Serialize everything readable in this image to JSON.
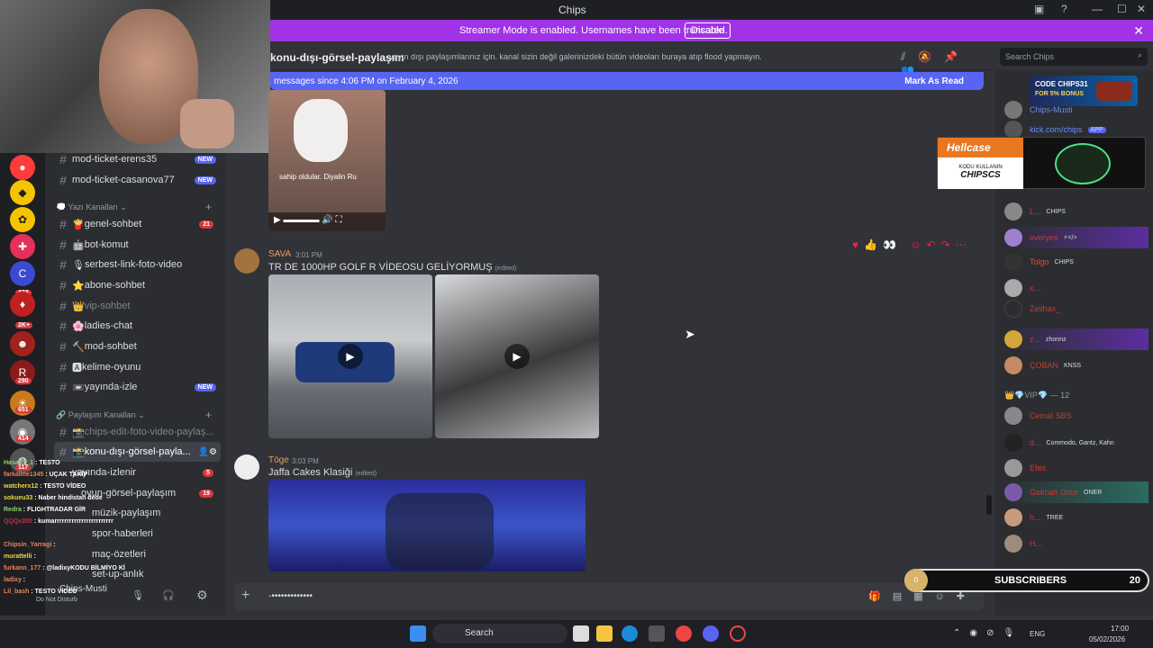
{
  "window": {
    "title": "Chips"
  },
  "banner": {
    "text": "Streamer Mode is enabled. Usernames have been truncated.",
    "button": "Disable"
  },
  "header": {
    "channel": "konu-dışı-görsel-paylaşım",
    "topic": "yayın dışı paylaşımlarınız için. kanal sizin değil galerinizdeki bütün videoları buraya atıp flood yapmayın.",
    "search_placeholder": "Search Chips"
  },
  "newbar": {
    "text": "messages since 4:06 PM on February 4, 2026",
    "action": "Mark As Read"
  },
  "rail_badges": [
    "433",
    "2K+",
    "290",
    "651",
    "414",
    "117"
  ],
  "sidebar": {
    "channels_top": [
      {
        "name": "mod-ticket-erens35",
        "badge": "NEW"
      },
      {
        "name": "mod-ticket-casanova77",
        "badge": "NEW"
      }
    ],
    "category1": "Yazı Kanalları",
    "channels": [
      {
        "name": "genel-sohbet",
        "prefix": "🍟",
        "count": "21"
      },
      {
        "name": "bot-komut",
        "prefix": "🤖"
      },
      {
        "name": "serbest-link-foto-video",
        "prefix": "🎙"
      },
      {
        "name": "abone-sohbet",
        "prefix": "⭐"
      },
      {
        "name": "vip-sohbet",
        "prefix": "👑",
        "muted": true
      },
      {
        "name": "ladies-chat",
        "prefix": "🌸"
      },
      {
        "name": "mod-sohbet",
        "prefix": "🔨"
      },
      {
        "name": "kelime-oyunu",
        "prefix": "🅰"
      },
      {
        "name": "yayında-izle",
        "prefix": "📼",
        "badge": "NEW"
      }
    ],
    "category2": "Paylaşım Kanalları",
    "channels2": [
      {
        "name": "chips-edit-foto-video-paylaş...",
        "prefix": "📸",
        "muted": true
      },
      {
        "name": "konu-dışı-görsel-payla...",
        "prefix": "📸",
        "active": true
      },
      {
        "name": "yayında-izlenir",
        "count": "5"
      },
      {
        "name": "oyun-görsel-paylaşım",
        "count": "19"
      },
      {
        "name": "müzik-paylaşım"
      },
      {
        "name": "spor-haberleri"
      },
      {
        "name": "maç-özetleri"
      },
      {
        "name": "set-up-anlık"
      }
    ],
    "user_status": "Do Not Disturb",
    "user_name": "Chips-Musti"
  },
  "messages": [
    {
      "author": "SAVA",
      "time": "3:01 PM",
      "text": "TR DE 1000HP GOLF R VİDEOSU GELİYORMUŞ",
      "edited": "(edited)"
    },
    {
      "author": "Töge",
      "time": "3:03 PM",
      "text": "Jaffa Cakes Klasiği",
      "edited": "(edited)"
    }
  ],
  "video_caption": "sahip oldular. Diyalin Ru",
  "composer": {
    "text": "-•••••••••••••"
  },
  "members": [
    {
      "name": "Chips-Musti",
      "color": "#6a8cff"
    },
    {
      "name": "kick.com/chips",
      "tag": "APP",
      "color": "#6a8cff"
    },
    {
      "name": "L...",
      "tag": "CHIPS",
      "color": "#c53b35"
    },
    {
      "name": "overyes",
      "tag": "⚡</>",
      "color": "#c53b35"
    },
    {
      "name": "Tolgo",
      "tag": "CHIPS",
      "color": "#e24b3b"
    },
    {
      "name": "x...",
      "color": "#c53b35"
    },
    {
      "name": "Zelihax_",
      "color": "#c53b35"
    },
    {
      "name": "z...",
      "tag": "zhonnz",
      "color": "#c53b35"
    },
    {
      "name": "ÇOBAN",
      "tag": "KNSS",
      "color": "#c53b35"
    }
  ],
  "vip": {
    "label": "VIP",
    "count": "— 12"
  },
  "vip_members": [
    {
      "name": "Cemal SBS",
      "color": "#c53b35"
    },
    {
      "name": "d...",
      "tag": "Commodo, Gantz, Kahn",
      "color": "#c53b35"
    },
    {
      "name": "Efes",
      "color": "#c53b35"
    },
    {
      "name": "Gokhan Onur",
      "tag": "ONER",
      "color": "#c53b35"
    },
    {
      "name": "h...",
      "tag": "TREE",
      "color": "#c53b35"
    },
    {
      "name": "H...",
      "color": "#c53b35"
    }
  ],
  "chat_overlay": [
    {
      "user": "Hasann_1",
      "msg": "TESTO"
    },
    {
      "user": "farkaline1345",
      "msg": "UÇAK TAKİP"
    },
    {
      "user": "watcherx12",
      "msg": "TESTO VİDEO"
    },
    {
      "user": "sokueu33",
      "msg": "Naber hindistan dede"
    },
    {
      "user": "Redra",
      "msg": "FLIGHTRADAR GİR"
    },
    {
      "user": "QQQv200",
      "msg": "kumarrrrrrrrrrrrrrrrrrrrrrrr"
    },
    {
      "user": "Chipsin_Yarragi",
      "msg": ""
    },
    {
      "user": "murattelli",
      "msg": ""
    },
    {
      "user": "furkann_177",
      "msg": "@ladixyKODU BİLMİYO Kİ"
    },
    {
      "user": "ladixy",
      "msg": ""
    },
    {
      "user": "Lil_bash",
      "msg": "TESTO VİDEO"
    }
  ],
  "hellcase": {
    "brand": "Hellcase",
    "line1": "KODU KULLANIN",
    "code": "CHIPSCS"
  },
  "chips_banner": {
    "line1": "CODE CHIPS31",
    "line2": "FOR 5% BONUS"
  },
  "subs": {
    "label": "SUBSCRIBERS",
    "count": "20",
    "left": "0"
  },
  "taskbar": {
    "search": "Search",
    "lang": "ENG",
    "time": "17:00",
    "date": "05/02/2026"
  },
  "colors": {
    "accent": "#5865f2",
    "banner": "#a033e6",
    "danger": "#da373c"
  }
}
